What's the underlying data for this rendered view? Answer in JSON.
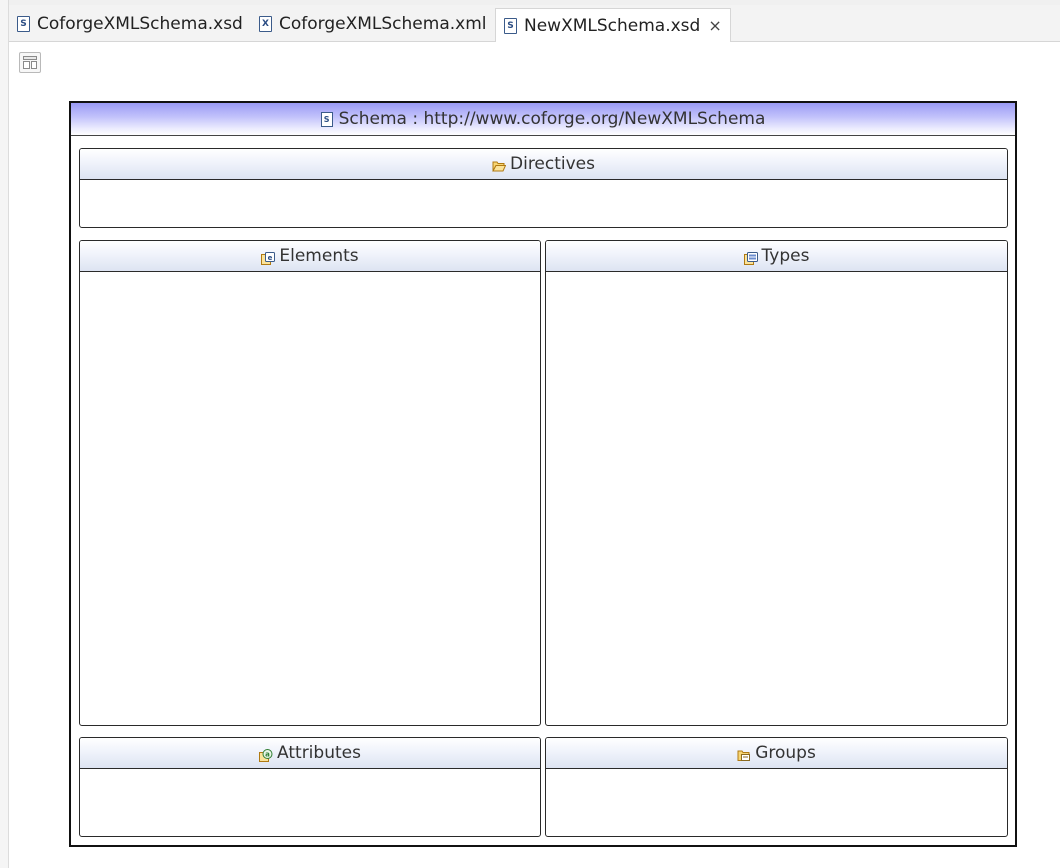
{
  "tabs": [
    {
      "label": "CoforgeXMLSchema.xsd",
      "icon": "xsd-file-icon",
      "icon_letter": "S",
      "active": false
    },
    {
      "label": "CoforgeXMLSchema.xml",
      "icon": "xml-file-icon",
      "icon_letter": "X",
      "active": false
    },
    {
      "label": "NewXMLSchema.xsd",
      "icon": "xsd-file-icon",
      "icon_letter": "S",
      "active": true
    }
  ],
  "active_tab_close": "×",
  "schema": {
    "icon_letter": "S",
    "title": "Schema : http://www.coforge.org/NewXMLSchema"
  },
  "sections": {
    "directives": "Directives",
    "elements": "Elements",
    "types": "Types",
    "attributes": "Attributes",
    "groups": "Groups"
  },
  "colors": {
    "schema_header": "#9a9af5",
    "panel_header": "#dde4f2",
    "border": "#111111"
  }
}
